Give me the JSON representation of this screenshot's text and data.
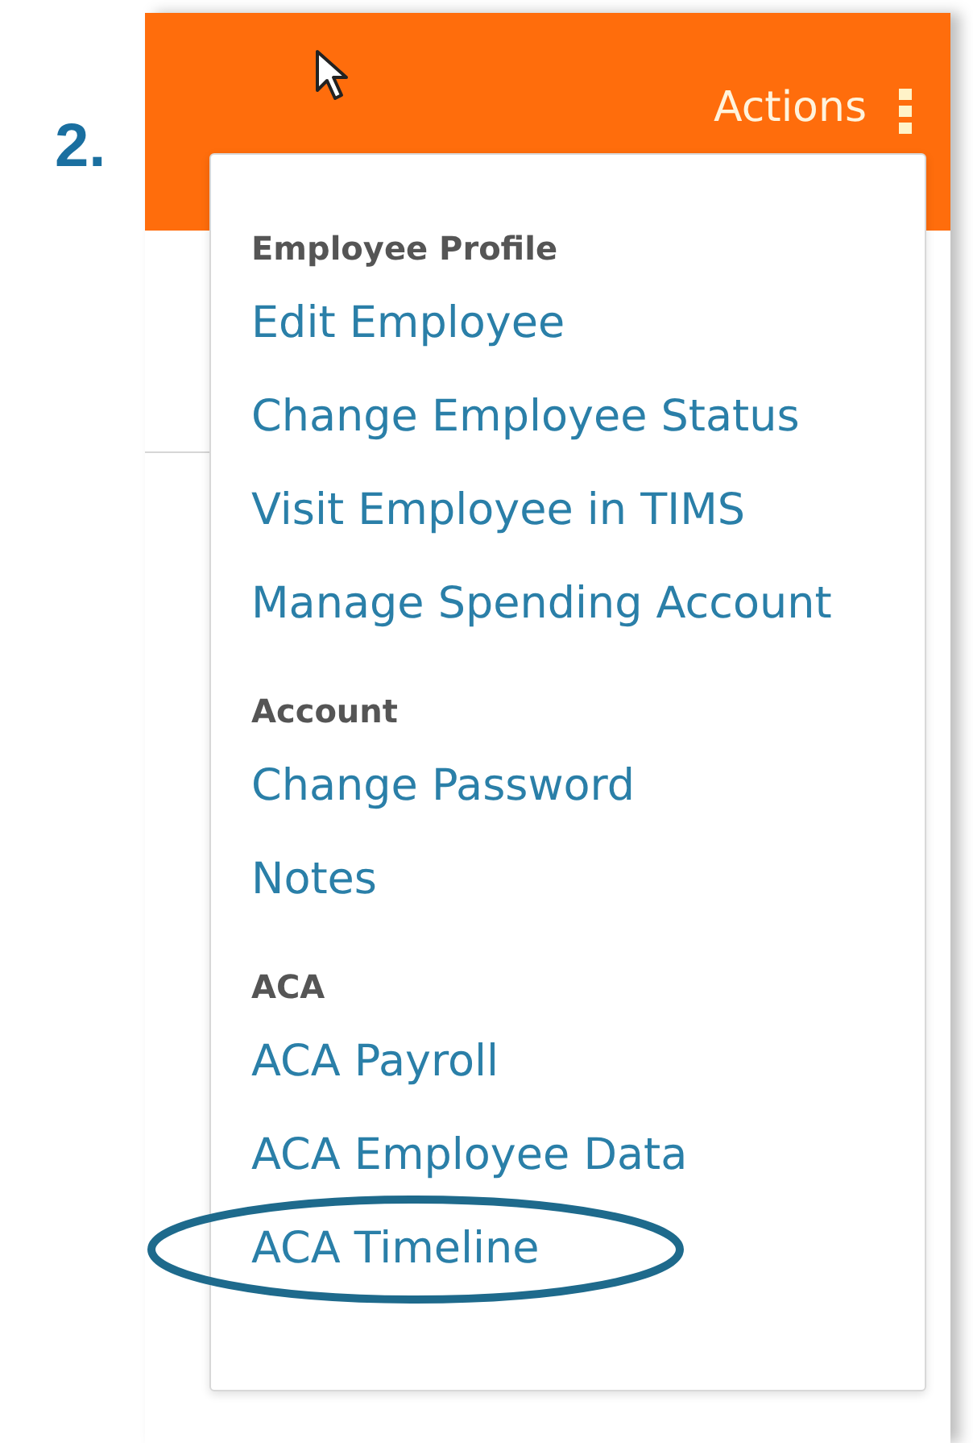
{
  "step_label": "2.",
  "header": {
    "title": "Actions"
  },
  "menu": {
    "sections": [
      {
        "heading": "Employee Profile",
        "items": [
          {
            "label": "Edit Employee"
          },
          {
            "label": "Change Employee Status"
          },
          {
            "label": "Visit Employee in TIMS"
          },
          {
            "label": "Manage Spending Account"
          }
        ]
      },
      {
        "heading": "Account",
        "items": [
          {
            "label": "Change Password"
          },
          {
            "label": "Notes"
          }
        ]
      },
      {
        "heading": "ACA",
        "items": [
          {
            "label": "ACA Payroll"
          },
          {
            "label": "ACA Employee Data"
          },
          {
            "label": "ACA Timeline",
            "circled": true
          }
        ]
      }
    ]
  }
}
